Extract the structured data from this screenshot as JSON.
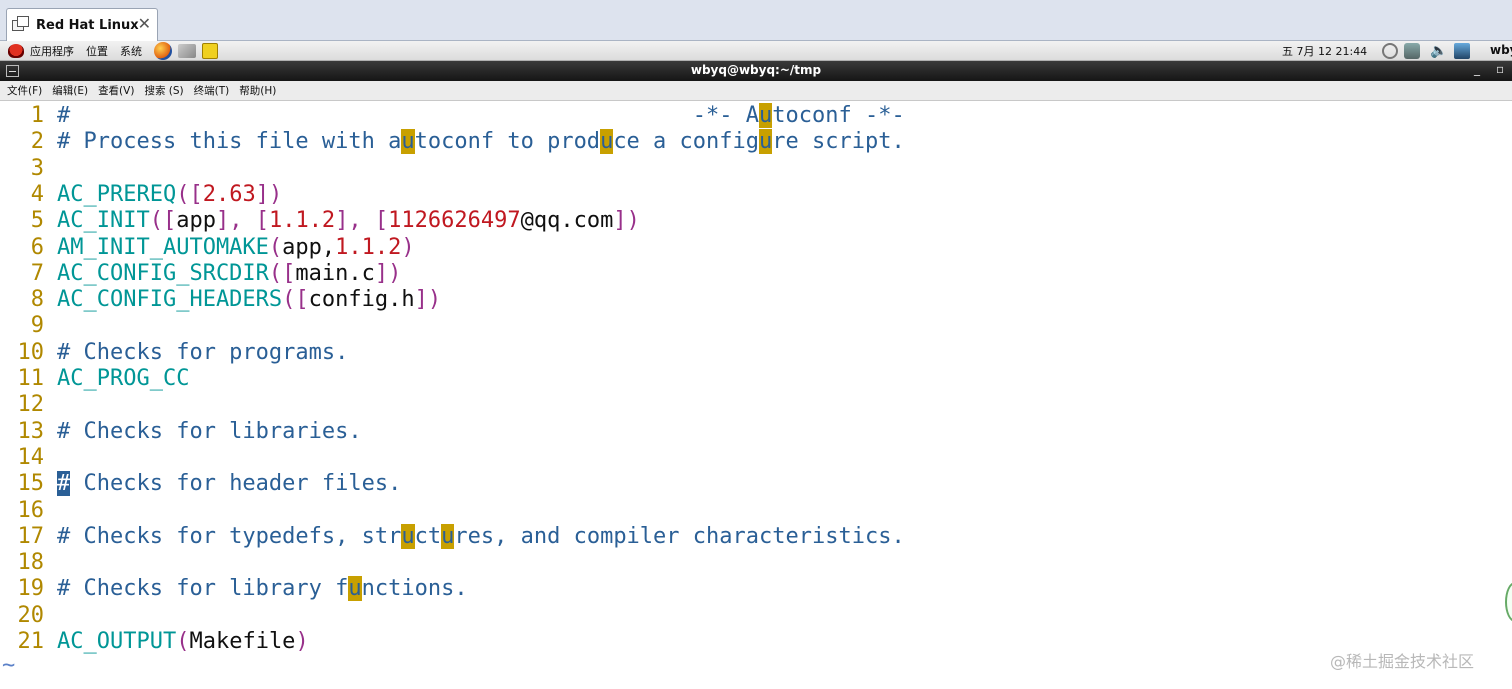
{
  "vm_tab": {
    "title": "Red Hat Linux",
    "close": "✕"
  },
  "panel": {
    "menus": [
      "应用程序",
      "位置",
      "系统"
    ],
    "clock": "五 7月 12 21:44",
    "user": "wby",
    "volume_glyph": "🔈"
  },
  "window": {
    "title": "wbyq@wbyq:~/tmp",
    "min": "_",
    "max": "▫"
  },
  "menubar": [
    "文件(F)",
    "编辑(E)",
    "查看(V)",
    "搜索 (S)",
    "终端(T)",
    "帮助(H)"
  ],
  "editor": {
    "lines": [
      {
        "n": "1",
        "segs": [
          {
            "c": "cm",
            "t": "#"
          },
          {
            "c": "cm",
            "t": "                                               -*- A"
          },
          {
            "c": "hl",
            "t": "u"
          },
          {
            "c": "cm",
            "t": "toconf -*-"
          }
        ]
      },
      {
        "n": "2",
        "segs": [
          {
            "c": "cm",
            "t": "# Process this file with a"
          },
          {
            "c": "hl",
            "t": "u"
          },
          {
            "c": "cm",
            "t": "toconf to prod"
          },
          {
            "c": "hl",
            "t": "u"
          },
          {
            "c": "cm",
            "t": "ce a config"
          },
          {
            "c": "hl",
            "t": "u"
          },
          {
            "c": "cm",
            "t": "re script."
          }
        ]
      },
      {
        "n": "3",
        "segs": []
      },
      {
        "n": "4",
        "segs": [
          {
            "c": "mac",
            "t": "AC_PREREQ"
          },
          {
            "c": "par",
            "t": "(["
          },
          {
            "c": "num",
            "t": "2.63"
          },
          {
            "c": "par",
            "t": "])"
          }
        ]
      },
      {
        "n": "5",
        "segs": [
          {
            "c": "mac",
            "t": "AC_INIT"
          },
          {
            "c": "par",
            "t": "(["
          },
          {
            "c": "txt",
            "t": "app"
          },
          {
            "c": "par",
            "t": "], ["
          },
          {
            "c": "num",
            "t": "1.1.2"
          },
          {
            "c": "par",
            "t": "], ["
          },
          {
            "c": "num",
            "t": "1126626497"
          },
          {
            "c": "txt",
            "t": "@qq.com"
          },
          {
            "c": "par",
            "t": "])"
          }
        ]
      },
      {
        "n": "6",
        "segs": [
          {
            "c": "mac",
            "t": "AM_INIT_AUTOMAKE"
          },
          {
            "c": "par",
            "t": "("
          },
          {
            "c": "txt",
            "t": "app,"
          },
          {
            "c": "num",
            "t": "1.1.2"
          },
          {
            "c": "par",
            "t": ")"
          }
        ]
      },
      {
        "n": "7",
        "segs": [
          {
            "c": "mac",
            "t": "AC_CONFIG_SRCDIR"
          },
          {
            "c": "par",
            "t": "(["
          },
          {
            "c": "txt",
            "t": "main.c"
          },
          {
            "c": "par",
            "t": "])"
          }
        ]
      },
      {
        "n": "8",
        "segs": [
          {
            "c": "mac",
            "t": "AC_CONFIG_HEADERS"
          },
          {
            "c": "par",
            "t": "(["
          },
          {
            "c": "txt",
            "t": "config.h"
          },
          {
            "c": "par",
            "t": "])"
          }
        ]
      },
      {
        "n": "9",
        "segs": []
      },
      {
        "n": "10",
        "segs": [
          {
            "c": "cm",
            "t": "# Checks for programs."
          }
        ]
      },
      {
        "n": "11",
        "segs": [
          {
            "c": "mac",
            "t": "AC_PROG_CC"
          }
        ]
      },
      {
        "n": "12",
        "segs": []
      },
      {
        "n": "13",
        "segs": [
          {
            "c": "cm",
            "t": "# Checks for libraries."
          }
        ]
      },
      {
        "n": "14",
        "segs": []
      },
      {
        "n": "15",
        "segs": [
          {
            "c": "cursor",
            "t": "#"
          },
          {
            "c": "cm",
            "t": " Checks for header files."
          }
        ]
      },
      {
        "n": "16",
        "segs": []
      },
      {
        "n": "17",
        "segs": [
          {
            "c": "cm",
            "t": "# Checks for typedefs, str"
          },
          {
            "c": "hl",
            "t": "u"
          },
          {
            "c": "cm",
            "t": "ct"
          },
          {
            "c": "hl",
            "t": "u"
          },
          {
            "c": "cm",
            "t": "res, and compiler characteristics."
          }
        ]
      },
      {
        "n": "18",
        "segs": []
      },
      {
        "n": "19",
        "segs": [
          {
            "c": "cm",
            "t": "# Checks for library f"
          },
          {
            "c": "hl",
            "t": "u"
          },
          {
            "c": "cm",
            "t": "nctions."
          }
        ]
      },
      {
        "n": "20",
        "segs": []
      },
      {
        "n": "21",
        "segs": [
          {
            "c": "mac",
            "t": "AC_OUTPUT"
          },
          {
            "c": "par",
            "t": "("
          },
          {
            "c": "txt",
            "t": "Makefile"
          },
          {
            "c": "par",
            "t": ")"
          }
        ]
      }
    ],
    "tilde": "~"
  },
  "watermark": "@稀土掘金技术社区",
  "colors": {
    "comment": "#2a5f96",
    "macro": "#009696",
    "paren": "#98308a",
    "number": "#c01820",
    "line_number": "#b08800",
    "search_highlight": "#c8a000"
  }
}
